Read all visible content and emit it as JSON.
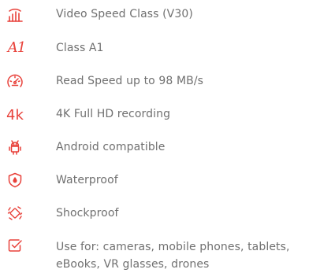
{
  "features": [
    {
      "icon": "video-speed-icon",
      "label": "Video Speed Class (V30)"
    },
    {
      "icon": "class-a1-icon",
      "icon_text": "A1",
      "label": "Class A1"
    },
    {
      "icon": "speedometer-icon",
      "label": "Read Speed up to 98 MB/s"
    },
    {
      "icon": "4k-icon",
      "icon_text": "4k",
      "label": "4K Full HD recording"
    },
    {
      "icon": "android-icon",
      "label": "Android compatible"
    },
    {
      "icon": "waterproof-icon",
      "label": "Waterproof"
    },
    {
      "icon": "shockproof-icon",
      "label": "Shockproof"
    },
    {
      "icon": "use-for-icon",
      "label": "Use for: cameras, mobile phones, tablets, eBooks, VR glasses, drones"
    }
  ],
  "colors": {
    "accent": "#e8413a",
    "text": "#707070"
  }
}
